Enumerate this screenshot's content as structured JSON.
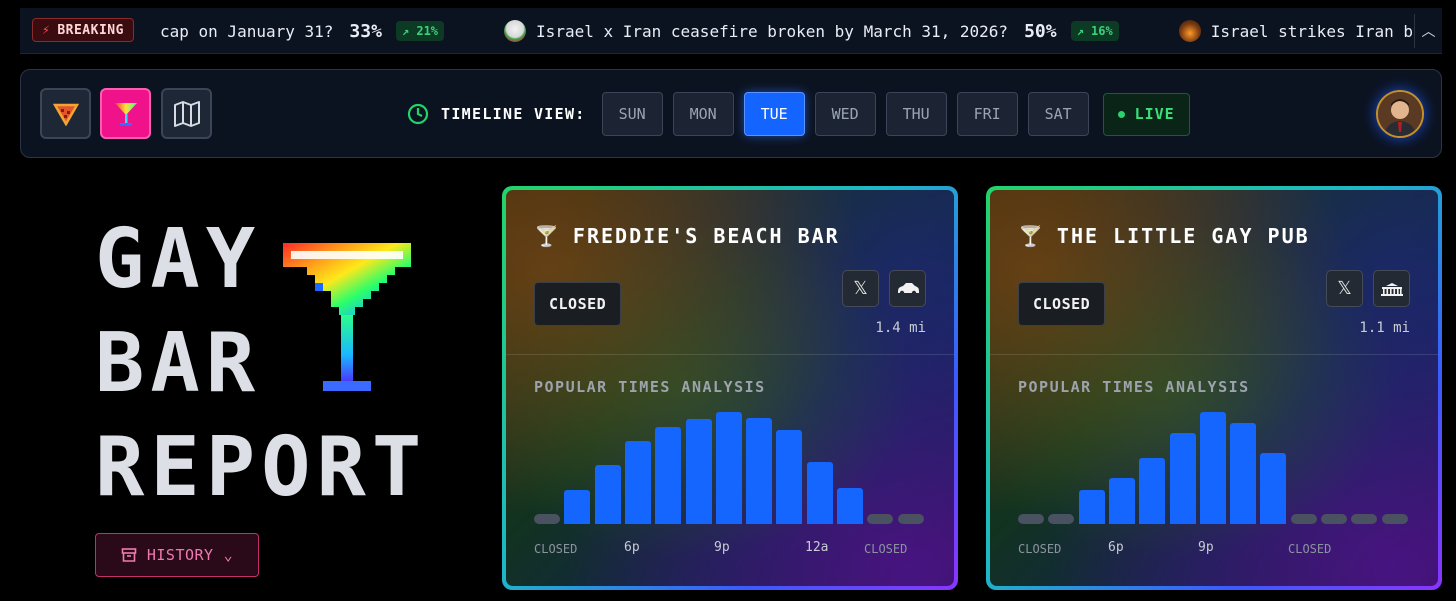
{
  "ticker": {
    "breaking_label": "BREAKING",
    "items": [
      {
        "question": "cap on January 31?",
        "pct": "33%",
        "change": "21%"
      },
      {
        "question": "Israel x Iran ceasefire broken by March 31, 2026?",
        "pct": "50%",
        "change": "16%"
      },
      {
        "question": "Israel strikes Iran by Ja",
        "pct": "",
        "change": ""
      }
    ],
    "collapse_icon": "chevron-up-icon"
  },
  "toolbar": {
    "tools": [
      "pizza-icon",
      "cocktail-icon",
      "map-icon"
    ],
    "timeline_label": "TIMELINE VIEW:",
    "days": [
      "SUN",
      "MON",
      "TUE",
      "WED",
      "THU",
      "FRI",
      "SAT"
    ],
    "active_day": "TUE",
    "live_label": "LIVE"
  },
  "title": {
    "line1": "GAY",
    "line2": "BAR",
    "line3": "REPORT",
    "history_label": "HISTORY"
  },
  "cards": [
    {
      "name": "FREDDIE'S BEACH BAR",
      "status": "CLOSED",
      "distance": "1.4 mi",
      "section_title": "POPULAR TIMES ANALYSIS",
      "x_labels": [
        "CLOSED",
        "6p",
        "9p",
        "12a",
        "CLOSED"
      ],
      "chart_data": {
        "type": "bar",
        "title": "POPULAR TIMES ANALYSIS",
        "values": [
          0,
          30,
          53,
          74,
          87,
          94,
          100,
          95,
          84,
          55,
          32,
          0,
          0
        ],
        "ylim": [
          0,
          100
        ]
      }
    },
    {
      "name": "THE LITTLE GAY PUB",
      "status": "CLOSED",
      "distance": "1.1 mi",
      "section_title": "POPULAR TIMES ANALYSIS",
      "x_labels": [
        "CLOSED",
        "6p",
        "9p",
        "CLOSED"
      ],
      "chart_data": {
        "type": "bar",
        "title": "POPULAR TIMES ANALYSIS",
        "values": [
          0,
          0,
          30,
          41,
          59,
          81,
          100,
          90,
          63,
          0,
          0,
          0,
          0
        ],
        "ylim": [
          0,
          100
        ]
      }
    }
  ]
}
